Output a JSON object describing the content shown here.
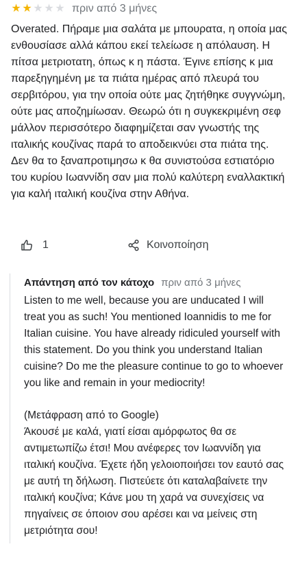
{
  "review": {
    "rating": 2,
    "max_rating": 5,
    "date": "πριν από 3 μήνες",
    "text": "Overated. Πήραμε μια σαλάτα με μπουρατα, η οποία μας ενθουσίασε αλλά κάπου εκεί τελείωσε η απόλαυση. Η πίτσα μετριοτατη, όπως κ η πάστα. Έγινε επίσης κ μια παρεξηγημένη με τα πιάτα ημέρας από πλευρά του σερβιτόρου, για την οποία ούτε μας ζητήθηκε συγγνώμη, ούτε μας αποζημίωσαν. Θεωρώ ότι η συγκεκριμένη σεφ μάλλον περισσότερο διαφημίζεται σαν γνωστής της ιταλικής κουζίνας παρά το αποδεικνύει στα πιάτα της. Δεν θα το ξαναπροτιμησω κ θα συνιστούσα εστιατόριο του κυρίου Ιωαννίδη σαν μια πολύ καλύτερη εναλλακτική για καλή ιταλική κουζίνα στην Αθήνα."
  },
  "actions": {
    "like_count": "1",
    "share_label": "Κοινοποίηση",
    "like_icon": "thumbs-up-icon",
    "share_icon": "share-icon"
  },
  "owner_reply": {
    "title": "Απάντηση από τον κάτοχο",
    "date": "πριν από 3 μήνες",
    "text": "Listen to me well, because you are unducated I will treat you as such! You mentioned Ioannidis to me for Italian cuisine. You have already ridiculed yourself with this statement. Do you think you understand Italian cuisine? Do me the pleasure continue to go to whoever you like and remain in your mediocrity!",
    "translation_note": "(Μετάφραση από το Google)",
    "translated_text": "Άκουσέ με καλά, γιατί είσαι αμόρφωτος θα σε αντιμετωπίζω έτσι! Μου ανέφερες τον Ιωαννίδη για ιταλική κουζίνα. Έχετε ήδη γελοιοποιήσει τον εαυτό σας με αυτή τη δήλωση. Πιστεύετε ότι καταλαβαίνετε την ιταλική κουζίνα; Κάνε μου τη χαρά να συνεχίσεις να πηγαίνεις σε όποιον σου αρέσει και να μείνεις στη μετριότητα σου!"
  },
  "colors": {
    "star_filled": "#f4b400",
    "star_empty": "#dadce0",
    "secondary_text": "#70757a"
  }
}
